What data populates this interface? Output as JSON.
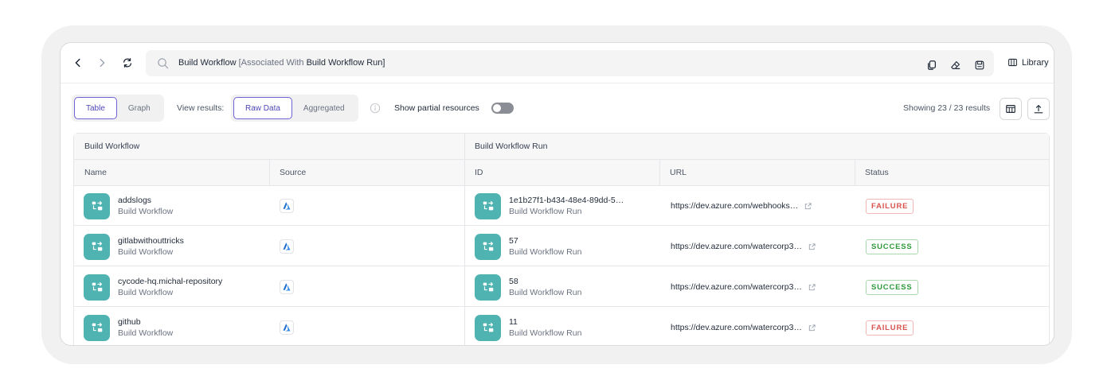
{
  "toolbar": {
    "query_prefix": "Build Workflow",
    "query_mid": "[Associated With",
    "query_target": "Build Workflow Run",
    "query_suffix": "]",
    "library_label": "Library"
  },
  "controls": {
    "view_tabs": [
      "Table",
      "Graph"
    ],
    "active_view": "Table",
    "view_results_label": "View results:",
    "result_modes": [
      "Raw Data",
      "Aggregated"
    ],
    "active_mode": "Raw Data",
    "partial_label": "Show partial resources",
    "partial_enabled": false,
    "showing_text": "Showing 23 / 23 results"
  },
  "table": {
    "groups": [
      "Build Workflow",
      "Build Workflow Run"
    ],
    "columns": [
      "Name",
      "Source",
      "ID",
      "URL",
      "Status"
    ],
    "rows": [
      {
        "name": "addslogs",
        "name_type": "Build Workflow",
        "source": "azure-devops-icon",
        "id": "1e1b27f1-b434-48e4-89dd-5…",
        "id_type": "Build Workflow Run",
        "url": "https://dev.azure.com/webhooks…",
        "status": "FAILURE"
      },
      {
        "name": "gitlabwithouttricks",
        "name_type": "Build Workflow",
        "source": "azure-devops-icon",
        "id": "57",
        "id_type": "Build Workflow Run",
        "url": "https://dev.azure.com/watercorp3…",
        "status": "SUCCESS"
      },
      {
        "name": "cycode-hq.michal-repository",
        "name_type": "Build Workflow",
        "source": "azure-devops-icon",
        "id": "58",
        "id_type": "Build Workflow Run",
        "url": "https://dev.azure.com/watercorp3…",
        "status": "SUCCESS"
      },
      {
        "name": "github",
        "name_type": "Build Workflow",
        "source": "azure-devops-icon",
        "id": "11",
        "id_type": "Build Workflow Run",
        "url": "https://dev.azure.com/watercorp3…",
        "status": "FAILURE"
      }
    ]
  },
  "colors": {
    "accent": "#4f46b5",
    "tile": "#4fb3b2",
    "failure": "#d9534f",
    "success": "#2e9a3b"
  }
}
